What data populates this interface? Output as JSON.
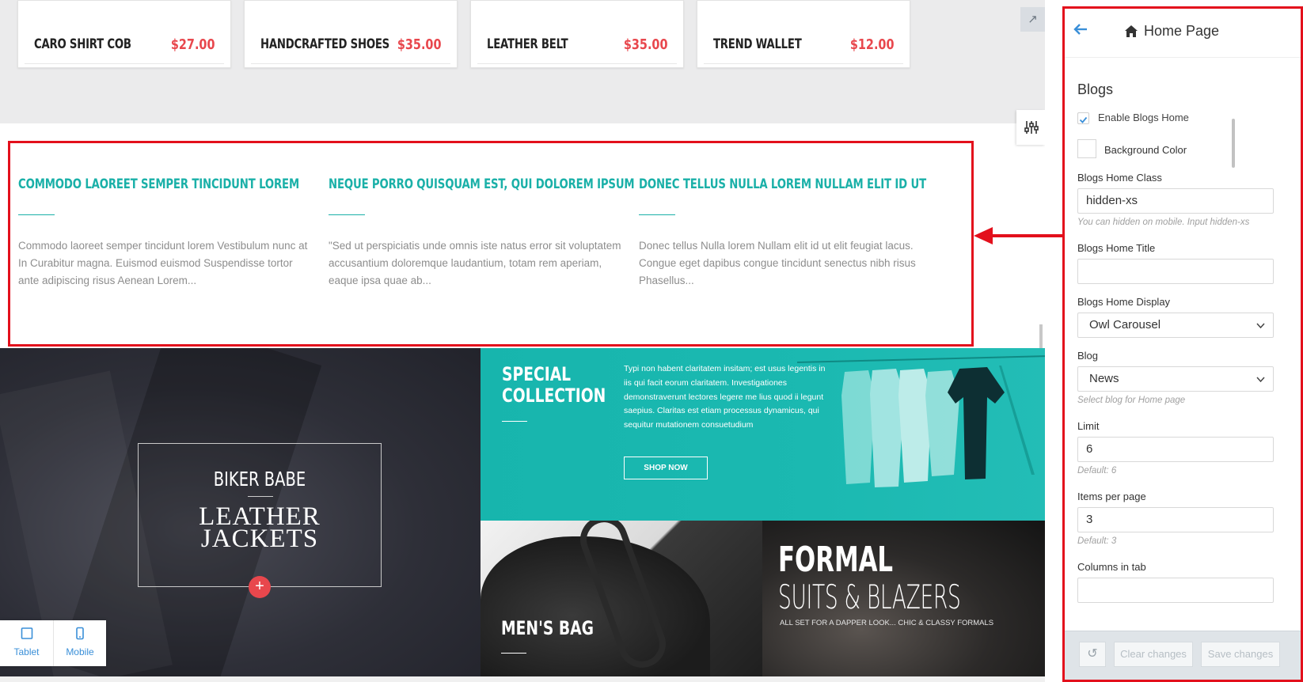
{
  "products": [
    {
      "name": "CARO SHIRT COB",
      "price": "$27.00"
    },
    {
      "name": "HANDCRAFTED SHOES",
      "price": "$35.00"
    },
    {
      "name": "LEATHER BELT",
      "price": "$35.00"
    },
    {
      "name": "TREND WALLET",
      "price": "$12.00"
    }
  ],
  "expand_icon": "↗",
  "blogs": [
    {
      "title": "COMMODO LAOREET SEMPER TINCIDUNT LOREM",
      "excerpt": "Commodo laoreet semper tincidunt lorem Vestibulum nunc at In Curabitur magna. Euismod euismod Suspendisse tortor ante adipiscing risus Aenean Lorem..."
    },
    {
      "title": "NEQUE PORRO QUISQUAM EST, QUI DOLOREM IPSUM",
      "excerpt": "\"Sed ut perspiciatis unde omnis iste natus error sit voluptatem accusantium doloremque laudantium, totam rem aperiam, eaque ipsa quae ab..."
    },
    {
      "title": "DONEC TELLUS NULLA LOREM NULLAM ELIT ID UT",
      "excerpt": "Donec tellus Nulla lorem Nullam elit id ut elit feugiat lacus. Congue eget dapibus congue tincidunt senectus nibh risus Phasellus..."
    }
  ],
  "banners": {
    "biker": {
      "top": "BIKER BABE",
      "main_line1": "LEATHER",
      "main_line2": "JACKETS",
      "plus": "+"
    },
    "special": {
      "title_line1": "SPECIAL",
      "title_line2": "COLLECTION",
      "text": "Typi non habent claritatem insitam; est usus legentis in iis qui facit eorum claritatem. Investigationes demonstraverunt lectores legere me lius quod ii legunt saepius. Claritas est etiam processus dynamicus, qui sequitur mutationem consuetudium",
      "button": "SHOP NOW"
    },
    "bag": {
      "title": "MEN'S BAG"
    },
    "formal": {
      "title": "FORMAL",
      "subtitle": "SUITS & BLAZERS",
      "tagline": "ALL SET FOR A DAPPER LOOK... CHIC & CLASSY FORMALS"
    }
  },
  "device_bar": {
    "tablet": "Tablet",
    "mobile": "Mobile"
  },
  "panel": {
    "title": "Home Page",
    "section": "Blogs",
    "enable_label": "Enable Blogs Home",
    "bg_color_label": "Background Color",
    "class_label": "Blogs Home Class",
    "class_value": "hidden-xs",
    "class_hint": "You can hidden on mobile. Input hidden-xs",
    "title_label": "Blogs Home Title",
    "title_value": "",
    "display_label": "Blogs Home Display",
    "display_value": "Owl Carousel",
    "blog_label": "Blog",
    "blog_value": "News",
    "blog_hint": "Select blog for Home page",
    "limit_label": "Limit",
    "limit_value": "6",
    "limit_hint": "Default: 6",
    "items_label": "Items per page",
    "items_value": "3",
    "items_hint": "Default: 3",
    "columns_label": "Columns in tab",
    "clear_label": "Clear changes",
    "save_label": "Save changes",
    "undo_icon": "↺"
  },
  "colors": {
    "accent_teal": "#1ab0a8",
    "price_red": "#e8474d",
    "highlight_red": "#e3101c",
    "link_blue": "#3a8fd8"
  }
}
